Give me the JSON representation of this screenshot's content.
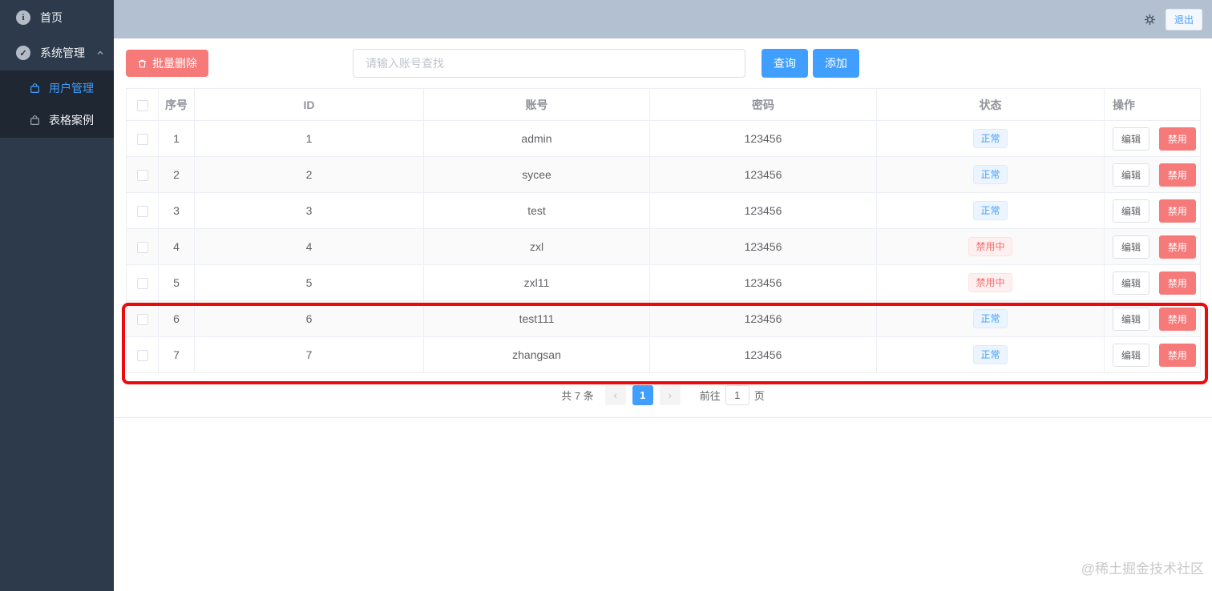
{
  "sidebar": {
    "items": [
      {
        "label": "首页",
        "icon": "info-icon"
      },
      {
        "label": "系统管理",
        "icon": "check-circle-icon"
      },
      {
        "label": "用户管理",
        "icon": "bag-icon",
        "active": true
      },
      {
        "label": "表格案例",
        "icon": "bag-icon"
      }
    ]
  },
  "topbar": {
    "logout_label": "退出",
    "gear": "gear-icon"
  },
  "toolbar": {
    "batch_delete_label": "批量删除",
    "search_placeholder": "请输入账号查找",
    "query_label": "查询",
    "add_label": "添加"
  },
  "table": {
    "headers": [
      "序号",
      "ID",
      "账号",
      "密码",
      "状态",
      "操作"
    ],
    "edit_label": "编辑",
    "disable_label": "禁用",
    "rows": [
      {
        "index": "1",
        "id": "1",
        "account": "admin",
        "password": "123456",
        "status": "正常",
        "status_type": "normal"
      },
      {
        "index": "2",
        "id": "2",
        "account": "sycee",
        "password": "123456",
        "status": "正常",
        "status_type": "normal"
      },
      {
        "index": "3",
        "id": "3",
        "account": "test",
        "password": "123456",
        "status": "正常",
        "status_type": "normal"
      },
      {
        "index": "4",
        "id": "4",
        "account": "zxl",
        "password": "123456",
        "status": "禁用中",
        "status_type": "disabled"
      },
      {
        "index": "5",
        "id": "5",
        "account": "zxl11",
        "password": "123456",
        "status": "禁用中",
        "status_type": "disabled"
      },
      {
        "index": "6",
        "id": "6",
        "account": "test111",
        "password": "123456",
        "status": "正常",
        "status_type": "normal"
      },
      {
        "index": "7",
        "id": "7",
        "account": "zhangsan",
        "password": "123456",
        "status": "正常",
        "status_type": "normal"
      }
    ]
  },
  "pagination": {
    "total_text": "共 7 条",
    "prev_icon": "‹",
    "next_icon": "›",
    "current_page": "1",
    "goto_prefix": "前往",
    "goto_value": "1",
    "goto_suffix": "页"
  },
  "watermark": "@稀土掘金技术社区",
  "colors": {
    "accent": "#409eff",
    "danger": "#f56c6c",
    "sidebar": "#2d3a4b",
    "sidebar_submenu": "#1f2733",
    "topbar": "#b3c0d1",
    "annotation": "#ec0b0b",
    "stripe_row": "#fafafa",
    "badge_normal_bg": "#ecf5ff",
    "badge_danger_bg": "#fef0f0"
  }
}
